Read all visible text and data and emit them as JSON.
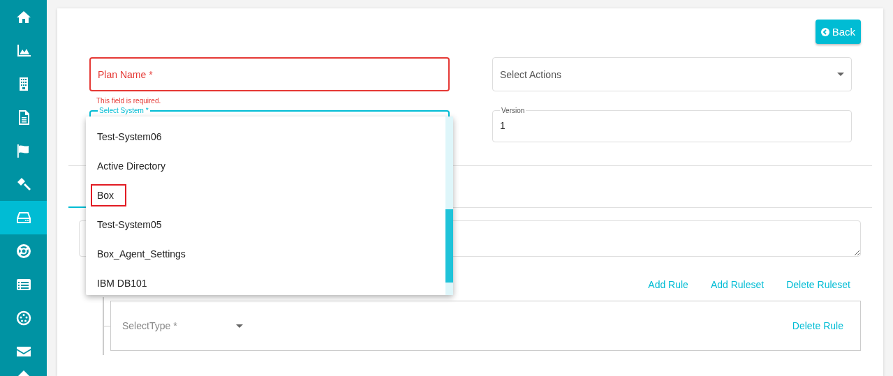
{
  "sidebar": {
    "items": [
      {
        "kind": "home",
        "selected": false
      },
      {
        "kind": "area-chart",
        "selected": false
      },
      {
        "kind": "building",
        "selected": false
      },
      {
        "kind": "document",
        "selected": false
      },
      {
        "kind": "flag",
        "selected": false
      },
      {
        "kind": "gavel",
        "selected": false
      },
      {
        "kind": "drive",
        "selected": true
      },
      {
        "kind": "life-ring",
        "selected": false
      },
      {
        "kind": "list",
        "selected": false
      },
      {
        "kind": "dots-circle",
        "selected": false
      },
      {
        "kind": "envelope",
        "selected": false
      },
      {
        "kind": "caret",
        "selected": false
      }
    ]
  },
  "back_button": {
    "label": "Back"
  },
  "form": {
    "plan_name": {
      "placeholder": "Plan Name *",
      "invalid": true,
      "error": "This field is required."
    },
    "select_actions": {
      "placeholder": "Select Actions"
    },
    "select_system": {
      "label": "Select System *",
      "focused": true,
      "options": [
        {
          "label": "Test-System06",
          "highlighted": false
        },
        {
          "label": "Active Directory",
          "highlighted": false
        },
        {
          "label": "Box",
          "highlighted": true
        },
        {
          "label": "Test-System05",
          "highlighted": false
        },
        {
          "label": "Box_Agent_Settings",
          "highlighted": false
        },
        {
          "label": "IBM DB101",
          "highlighted": false
        }
      ]
    },
    "version": {
      "label": "Version",
      "value": "1"
    }
  },
  "rules": {
    "actions": [
      "Add Rule",
      "Add Ruleset",
      "Delete Ruleset"
    ],
    "rule": {
      "type_placeholder": "SelectType *",
      "delete_label": "Delete Rule"
    }
  }
}
